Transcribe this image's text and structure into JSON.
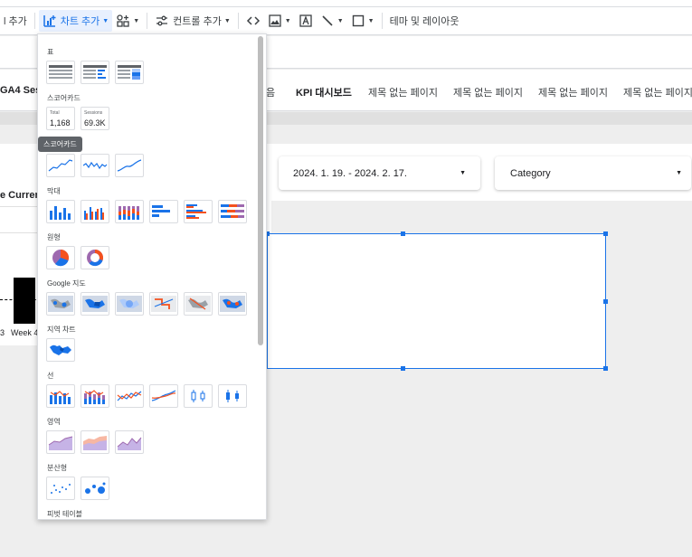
{
  "toolbar": {
    "page_add_label": "l 추가",
    "chart_add_label": "차트 추가",
    "control_add_label": "컨트롤 추가",
    "theme_layout_label": "테마 및 레이아웃"
  },
  "tabs": [
    {
      "label": "GA4 Sess",
      "bold": true
    },
    {
      "label": "음",
      "bold": false
    },
    {
      "label": "KPI 대시보드",
      "bold": true
    },
    {
      "label": "제목 없는 페이지",
      "bold": false
    },
    {
      "label": "제목 없는 페이지",
      "bold": false
    },
    {
      "label": "제목 없는 페이지",
      "bold": false
    },
    {
      "label": "제목 없는 페이지",
      "bold": false
    }
  ],
  "controls": {
    "date_range": "2024. 1. 19. - 2024. 2. 17.",
    "category": "Category"
  },
  "report": {
    "current_label": "e Current",
    "week3_label": "3",
    "week4_label": "Week 4"
  },
  "panel": {
    "sections": {
      "table": "표",
      "scorecard": "스코어카드",
      "timeseries": "",
      "bar": "막대",
      "pie": "원형",
      "google_maps": "Google 지도",
      "geo": "지역 차트",
      "line": "선",
      "area": "영역",
      "scatter": "분산형",
      "pivot": "피벗 테이블"
    },
    "scorecard1": {
      "title": "Total",
      "value": "1,168"
    },
    "scorecard2": {
      "title": "Sessions",
      "value": "69.3K"
    },
    "tooltip": "스코어카드"
  },
  "colors": {
    "accent": "#1a73e8",
    "orange": "#f4511e",
    "purple": "#9e69af"
  }
}
